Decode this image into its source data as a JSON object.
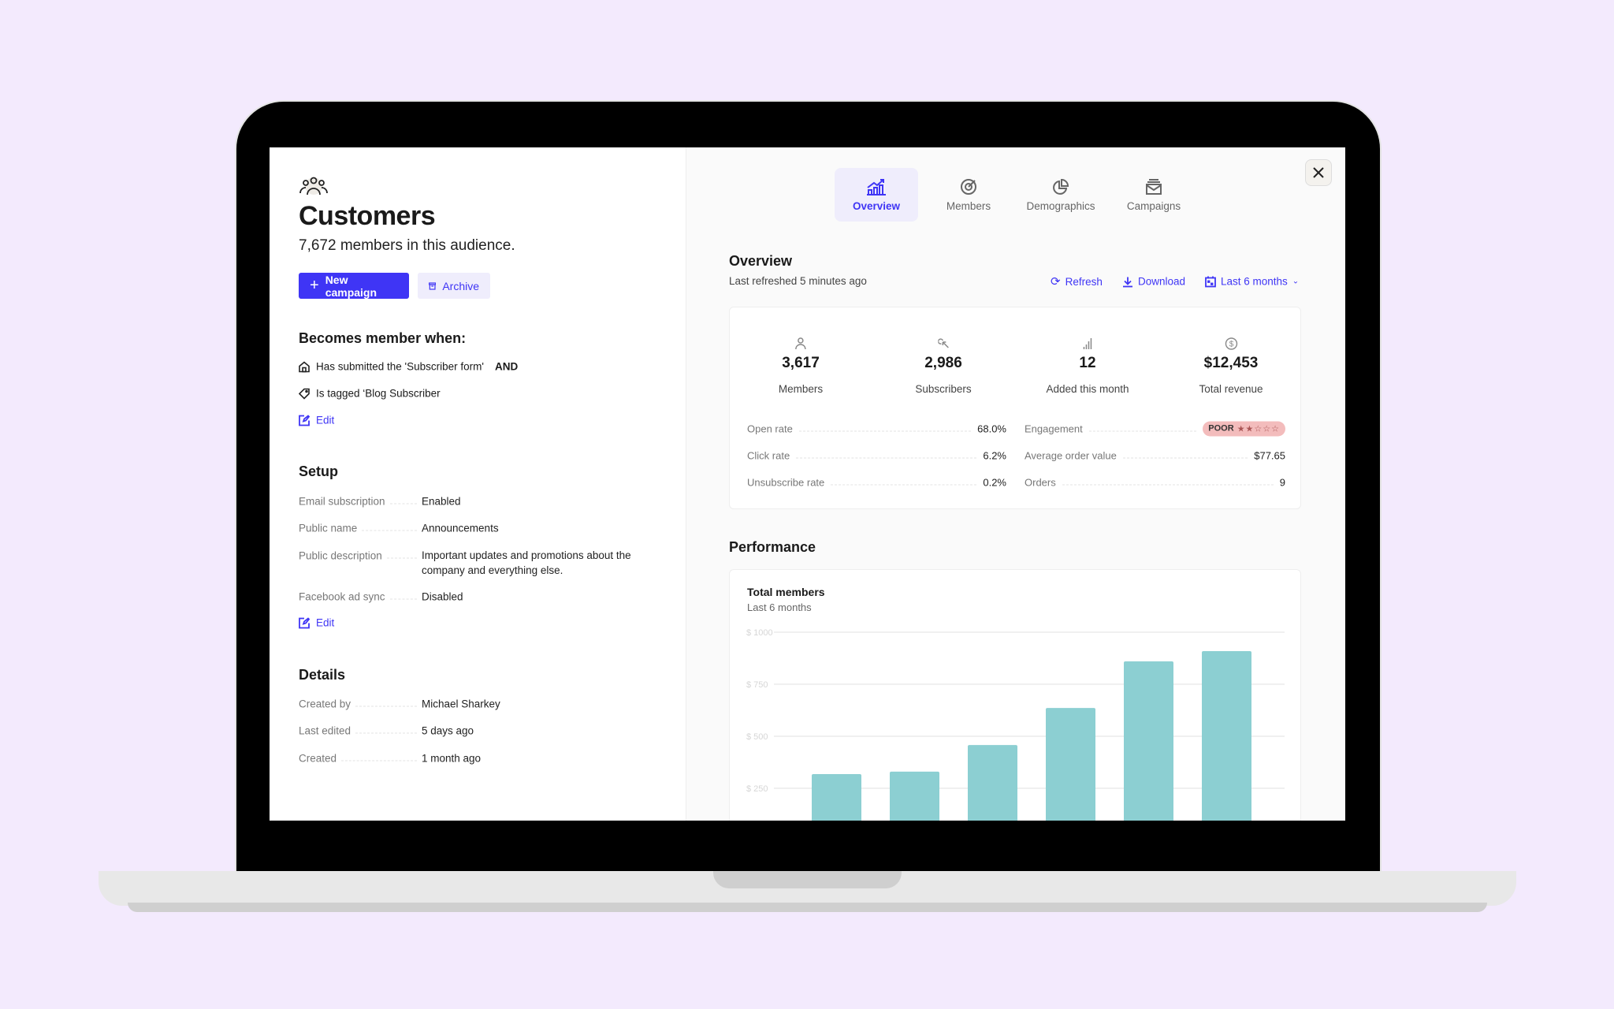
{
  "left": {
    "title": "Customers",
    "subtitle": "7,672 members in this audience.",
    "new_campaign_label": "New campaign",
    "archive_label": "Archive",
    "membership": {
      "heading": "Becomes member when:",
      "rule1": "Has submitted the 'Subscriber form'",
      "rule1_operator": "AND",
      "rule2": "Is tagged ‘Blog Subscriber",
      "edit_label": "Edit"
    },
    "setup": {
      "heading": "Setup",
      "rows": [
        {
          "label": "Email subscription",
          "value": "Enabled"
        },
        {
          "label": "Public name",
          "value": "Announcements"
        },
        {
          "label": "Public description",
          "value": "Important updates and promotions about the company and everything else."
        },
        {
          "label": "Facebook ad sync",
          "value": "Disabled"
        }
      ],
      "edit_label": "Edit"
    },
    "details": {
      "heading": "Details",
      "rows": [
        {
          "label": "Created by",
          "value": "Michael Sharkey"
        },
        {
          "label": "Last edited",
          "value": "5 days ago"
        },
        {
          "label": "Created",
          "value": "1 month ago"
        }
      ]
    }
  },
  "tabs": [
    {
      "label": "Overview",
      "icon": "chart-growth-icon",
      "active": true
    },
    {
      "label": "Members",
      "icon": "target-icon",
      "active": false
    },
    {
      "label": "Demographics",
      "icon": "pie-chart-icon",
      "active": false
    },
    {
      "label": "Campaigns",
      "icon": "mail-stack-icon",
      "active": false
    }
  ],
  "overview": {
    "heading": "Overview",
    "last_refreshed": "Last refreshed 5 minutes ago",
    "refresh_label": "Refresh",
    "download_label": "Download",
    "range_label": "Last 6 months",
    "stats": [
      {
        "value": "3,617",
        "label": "Members",
        "icon": "person-icon"
      },
      {
        "value": "2,986",
        "label": "Subscribers",
        "icon": "cursor-click-icon"
      },
      {
        "value": "12",
        "label": "Added this month",
        "icon": "signal-bars-icon"
      },
      {
        "value": "$12,453",
        "label": "Total revenue",
        "icon": "dollar-coin-icon"
      }
    ],
    "metrics_left": [
      {
        "label": "Open rate",
        "value": "68.0%"
      },
      {
        "label": "Click rate",
        "value": "6.2%"
      },
      {
        "label": "Unsubscribe rate",
        "value": "0.2%"
      }
    ],
    "metrics_right": [
      {
        "label": "Engagement",
        "value": "POOR",
        "stars": "★★☆☆☆",
        "rating": 2
      },
      {
        "label": "Average order value",
        "value": "$77.65"
      },
      {
        "label": "Orders",
        "value": "9"
      }
    ]
  },
  "performance": {
    "heading": "Performance"
  },
  "colors": {
    "accent": "#3f35f5",
    "bar": "#8ccfd2",
    "badge_poor": "#f3bcbc",
    "background": "#f3eafd"
  },
  "chart_data": {
    "type": "bar",
    "title": "Total members",
    "subtitle": "Last 6 months",
    "values": [
      318,
      330,
      458,
      636,
      860,
      909
    ],
    "yticks": [
      "$ 1000",
      "$ 750",
      "$ 500",
      "$ 250"
    ],
    "ytick_values": [
      1000,
      750,
      500,
      250
    ],
    "ylim": [
      0,
      1000
    ],
    "grid": true
  }
}
